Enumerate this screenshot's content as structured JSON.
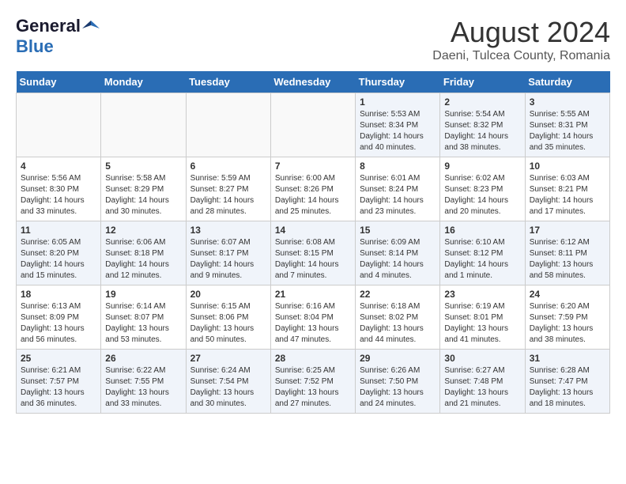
{
  "logo": {
    "general": "General",
    "blue": "Blue"
  },
  "title": {
    "month_year": "August 2024",
    "location": "Daeni, Tulcea County, Romania"
  },
  "days_of_week": [
    "Sunday",
    "Monday",
    "Tuesday",
    "Wednesday",
    "Thursday",
    "Friday",
    "Saturday"
  ],
  "weeks": [
    [
      {
        "day": "",
        "content": ""
      },
      {
        "day": "",
        "content": ""
      },
      {
        "day": "",
        "content": ""
      },
      {
        "day": "",
        "content": ""
      },
      {
        "day": "1",
        "content": "Sunrise: 5:53 AM\nSunset: 8:34 PM\nDaylight: 14 hours and 40 minutes."
      },
      {
        "day": "2",
        "content": "Sunrise: 5:54 AM\nSunset: 8:32 PM\nDaylight: 14 hours and 38 minutes."
      },
      {
        "day": "3",
        "content": "Sunrise: 5:55 AM\nSunset: 8:31 PM\nDaylight: 14 hours and 35 minutes."
      }
    ],
    [
      {
        "day": "4",
        "content": "Sunrise: 5:56 AM\nSunset: 8:30 PM\nDaylight: 14 hours and 33 minutes."
      },
      {
        "day": "5",
        "content": "Sunrise: 5:58 AM\nSunset: 8:29 PM\nDaylight: 14 hours and 30 minutes."
      },
      {
        "day": "6",
        "content": "Sunrise: 5:59 AM\nSunset: 8:27 PM\nDaylight: 14 hours and 28 minutes."
      },
      {
        "day": "7",
        "content": "Sunrise: 6:00 AM\nSunset: 8:26 PM\nDaylight: 14 hours and 25 minutes."
      },
      {
        "day": "8",
        "content": "Sunrise: 6:01 AM\nSunset: 8:24 PM\nDaylight: 14 hours and 23 minutes."
      },
      {
        "day": "9",
        "content": "Sunrise: 6:02 AM\nSunset: 8:23 PM\nDaylight: 14 hours and 20 minutes."
      },
      {
        "day": "10",
        "content": "Sunrise: 6:03 AM\nSunset: 8:21 PM\nDaylight: 14 hours and 17 minutes."
      }
    ],
    [
      {
        "day": "11",
        "content": "Sunrise: 6:05 AM\nSunset: 8:20 PM\nDaylight: 14 hours and 15 minutes."
      },
      {
        "day": "12",
        "content": "Sunrise: 6:06 AM\nSunset: 8:18 PM\nDaylight: 14 hours and 12 minutes."
      },
      {
        "day": "13",
        "content": "Sunrise: 6:07 AM\nSunset: 8:17 PM\nDaylight: 14 hours and 9 minutes."
      },
      {
        "day": "14",
        "content": "Sunrise: 6:08 AM\nSunset: 8:15 PM\nDaylight: 14 hours and 7 minutes."
      },
      {
        "day": "15",
        "content": "Sunrise: 6:09 AM\nSunset: 8:14 PM\nDaylight: 14 hours and 4 minutes."
      },
      {
        "day": "16",
        "content": "Sunrise: 6:10 AM\nSunset: 8:12 PM\nDaylight: 14 hours and 1 minute."
      },
      {
        "day": "17",
        "content": "Sunrise: 6:12 AM\nSunset: 8:11 PM\nDaylight: 13 hours and 58 minutes."
      }
    ],
    [
      {
        "day": "18",
        "content": "Sunrise: 6:13 AM\nSunset: 8:09 PM\nDaylight: 13 hours and 56 minutes."
      },
      {
        "day": "19",
        "content": "Sunrise: 6:14 AM\nSunset: 8:07 PM\nDaylight: 13 hours and 53 minutes."
      },
      {
        "day": "20",
        "content": "Sunrise: 6:15 AM\nSunset: 8:06 PM\nDaylight: 13 hours and 50 minutes."
      },
      {
        "day": "21",
        "content": "Sunrise: 6:16 AM\nSunset: 8:04 PM\nDaylight: 13 hours and 47 minutes."
      },
      {
        "day": "22",
        "content": "Sunrise: 6:18 AM\nSunset: 8:02 PM\nDaylight: 13 hours and 44 minutes."
      },
      {
        "day": "23",
        "content": "Sunrise: 6:19 AM\nSunset: 8:01 PM\nDaylight: 13 hours and 41 minutes."
      },
      {
        "day": "24",
        "content": "Sunrise: 6:20 AM\nSunset: 7:59 PM\nDaylight: 13 hours and 38 minutes."
      }
    ],
    [
      {
        "day": "25",
        "content": "Sunrise: 6:21 AM\nSunset: 7:57 PM\nDaylight: 13 hours and 36 minutes."
      },
      {
        "day": "26",
        "content": "Sunrise: 6:22 AM\nSunset: 7:55 PM\nDaylight: 13 hours and 33 minutes."
      },
      {
        "day": "27",
        "content": "Sunrise: 6:24 AM\nSunset: 7:54 PM\nDaylight: 13 hours and 30 minutes."
      },
      {
        "day": "28",
        "content": "Sunrise: 6:25 AM\nSunset: 7:52 PM\nDaylight: 13 hours and 27 minutes."
      },
      {
        "day": "29",
        "content": "Sunrise: 6:26 AM\nSunset: 7:50 PM\nDaylight: 13 hours and 24 minutes."
      },
      {
        "day": "30",
        "content": "Sunrise: 6:27 AM\nSunset: 7:48 PM\nDaylight: 13 hours and 21 minutes."
      },
      {
        "day": "31",
        "content": "Sunrise: 6:28 AM\nSunset: 7:47 PM\nDaylight: 13 hours and 18 minutes."
      }
    ]
  ]
}
